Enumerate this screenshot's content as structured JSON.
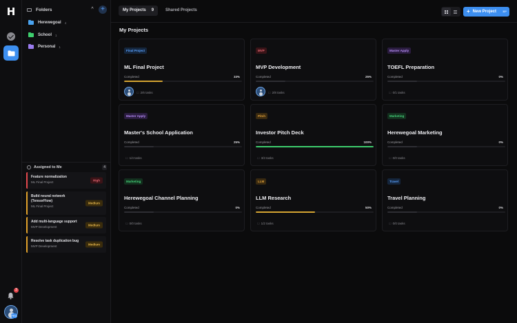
{
  "app": {
    "logo": "H"
  },
  "rail": {
    "icons": [
      "check-circle-icon",
      "folder-icon",
      "bell-icon",
      "avatar"
    ],
    "notification_count": "3",
    "user_badge": "PRO"
  },
  "folders": {
    "title": "Folders",
    "collapse": "^",
    "add": "+",
    "items": [
      {
        "name": "Herewegoal",
        "count": "4",
        "color": "#4aa3f0"
      },
      {
        "name": "School",
        "count": "1",
        "color": "#3ecf6e"
      },
      {
        "name": "Personal",
        "count": "1",
        "color": "#9b7cf0"
      }
    ]
  },
  "assigned": {
    "title": "Assigned to Me",
    "count": "4",
    "tasks": [
      {
        "title": "Feature normalization",
        "project": "ML Final Project",
        "priority": "High",
        "accent": "#e5484d"
      },
      {
        "title": "Build neural network (TensorFlow)",
        "project": "ML Final Project",
        "priority": "Medium",
        "accent": "#e2a22b"
      },
      {
        "title": "Add multi-language support",
        "project": "MVP Development",
        "priority": "Medium",
        "accent": "#e2a22b"
      },
      {
        "title": "Resolve task duplication bug",
        "project": "MVP Development",
        "priority": "Medium",
        "accent": "#e2a22b"
      }
    ]
  },
  "topbar": {
    "tab_my_projects": "My Projects",
    "tab_my_projects_count": "9",
    "tab_shared": "Shared Projects",
    "new_project_label": "New Project",
    "new_project_plus": "+",
    "new_project_shortcut": "⌘P"
  },
  "section_title": "My Projects",
  "completed_label": "Completed",
  "projects": [
    {
      "tag": "Final Project",
      "tag_fg": "#5aa2ff",
      "tag_bg": "#15263d",
      "title": "ML Final Project",
      "percent": "33%",
      "progress": 0.33,
      "bar_color": "#d6a532",
      "tasks": "2/6 tasks",
      "has_avatar": true
    },
    {
      "tag": "MVP",
      "tag_fg": "#e26570",
      "tag_bg": "#3a1418",
      "title": "MVP Development",
      "percent": "25%",
      "progress": 0.25,
      "bar_color": "#3a3a40",
      "tasks": "2/8 tasks",
      "has_avatar": true
    },
    {
      "tag": "Master Apply",
      "tag_fg": "#b58cf5",
      "tag_bg": "#2a1c3f",
      "title": "TOEFL Preparation",
      "percent": "0%",
      "progress": 0,
      "bar_color": "#3a3a40",
      "tasks": "0/1 tasks",
      "has_avatar": false
    },
    {
      "tag": "Master Apply",
      "tag_fg": "#b58cf5",
      "tag_bg": "#2a1c3f",
      "title": "Master's School Application",
      "percent": "25%",
      "progress": 0.25,
      "bar_color": "#3a3a40",
      "tasks": "1/4 tasks",
      "has_avatar": false
    },
    {
      "tag": "Pitch",
      "tag_fg": "#e2a23b",
      "tag_bg": "#3a2a10",
      "title": "Investor Pitch Deck",
      "percent": "100%",
      "progress": 1,
      "bar_color": "#3ecf6e",
      "tasks": "3/3 tasks",
      "has_avatar": false
    },
    {
      "tag": "Marketing",
      "tag_fg": "#45d07a",
      "tag_bg": "#13301e",
      "title": "Herewegoal Marketing",
      "percent": "0%",
      "progress": 0,
      "bar_color": "#3a3a40",
      "tasks": "0/0 tasks",
      "has_avatar": false
    },
    {
      "tag": "Marketing",
      "tag_fg": "#45d07a",
      "tag_bg": "#13301e",
      "title": "Herewegoal Channel Planning",
      "percent": "0%",
      "progress": 0,
      "bar_color": "#3a3a40",
      "tasks": "0/0 tasks",
      "has_avatar": false
    },
    {
      "tag": "LLM",
      "tag_fg": "#e2a23b",
      "tag_bg": "#3a2a10",
      "title": "LLM Research",
      "percent": "50%",
      "progress": 0.5,
      "bar_color": "#d6a532",
      "tasks": "1/2 tasks",
      "has_avatar": false
    },
    {
      "tag": "Travel",
      "tag_fg": "#5aa2ff",
      "tag_bg": "#15263d",
      "title": "Travel Planning",
      "percent": "0%",
      "progress": 0,
      "bar_color": "#3a3a40",
      "tasks": "0/0 tasks",
      "has_avatar": false
    }
  ]
}
